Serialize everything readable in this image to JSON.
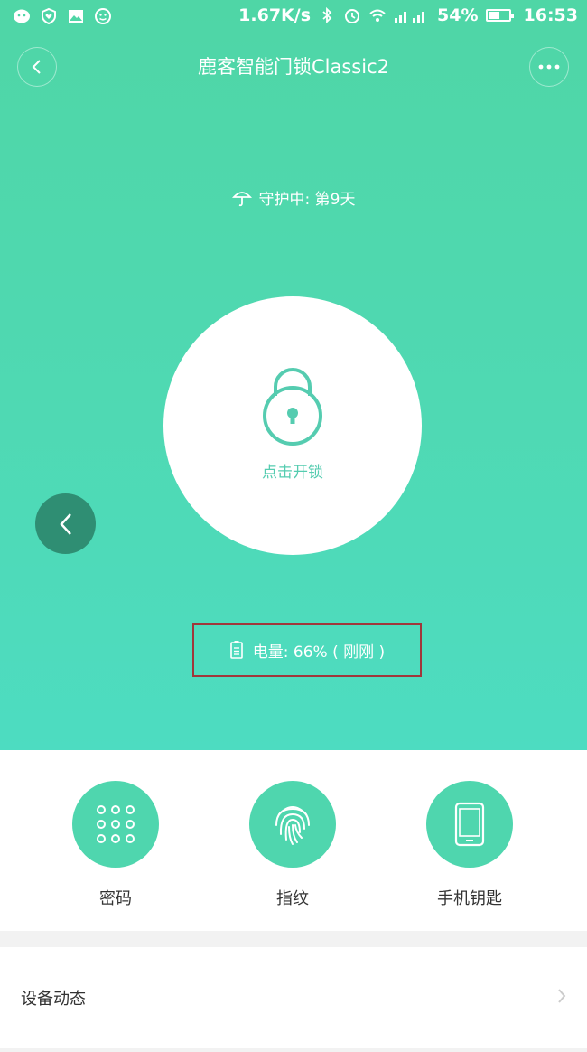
{
  "status_bar": {
    "speed": "1.67K/s",
    "battery": "54%",
    "time": "16:53",
    "icons": [
      "wechat-icon",
      "heart-shield-icon",
      "image-icon",
      "face-icon",
      "bluetooth-icon",
      "alarm-icon",
      "wifi-icon",
      "signal-icon",
      "battery-icon"
    ]
  },
  "header": {
    "title": "鹿客智能门锁Classic2",
    "back_icon": "chevron-left-icon",
    "more_icon": "more-dots-icon"
  },
  "guard": {
    "text": "守护中: 第9天",
    "icon": "umbrella-icon"
  },
  "lock": {
    "label": "点击开锁",
    "icon": "padlock-icon"
  },
  "battery_info": {
    "text": "电量: 66% ( 刚刚 )",
    "icon": "battery-doc-icon"
  },
  "actions": [
    {
      "label": "密码",
      "icon": "keypad-icon"
    },
    {
      "label": "指纹",
      "icon": "fingerprint-icon"
    },
    {
      "label": "手机钥匙",
      "icon": "phone-icon"
    }
  ],
  "device_row": {
    "label": "设备动态",
    "icon": "chevron-right-icon"
  },
  "colors": {
    "hero_top": "#4fd6a6",
    "hero_bottom": "#4ddcc1",
    "accent": "#4fd6ae",
    "side_button": "#2f8e73",
    "highlight_box": "#a0373b"
  }
}
